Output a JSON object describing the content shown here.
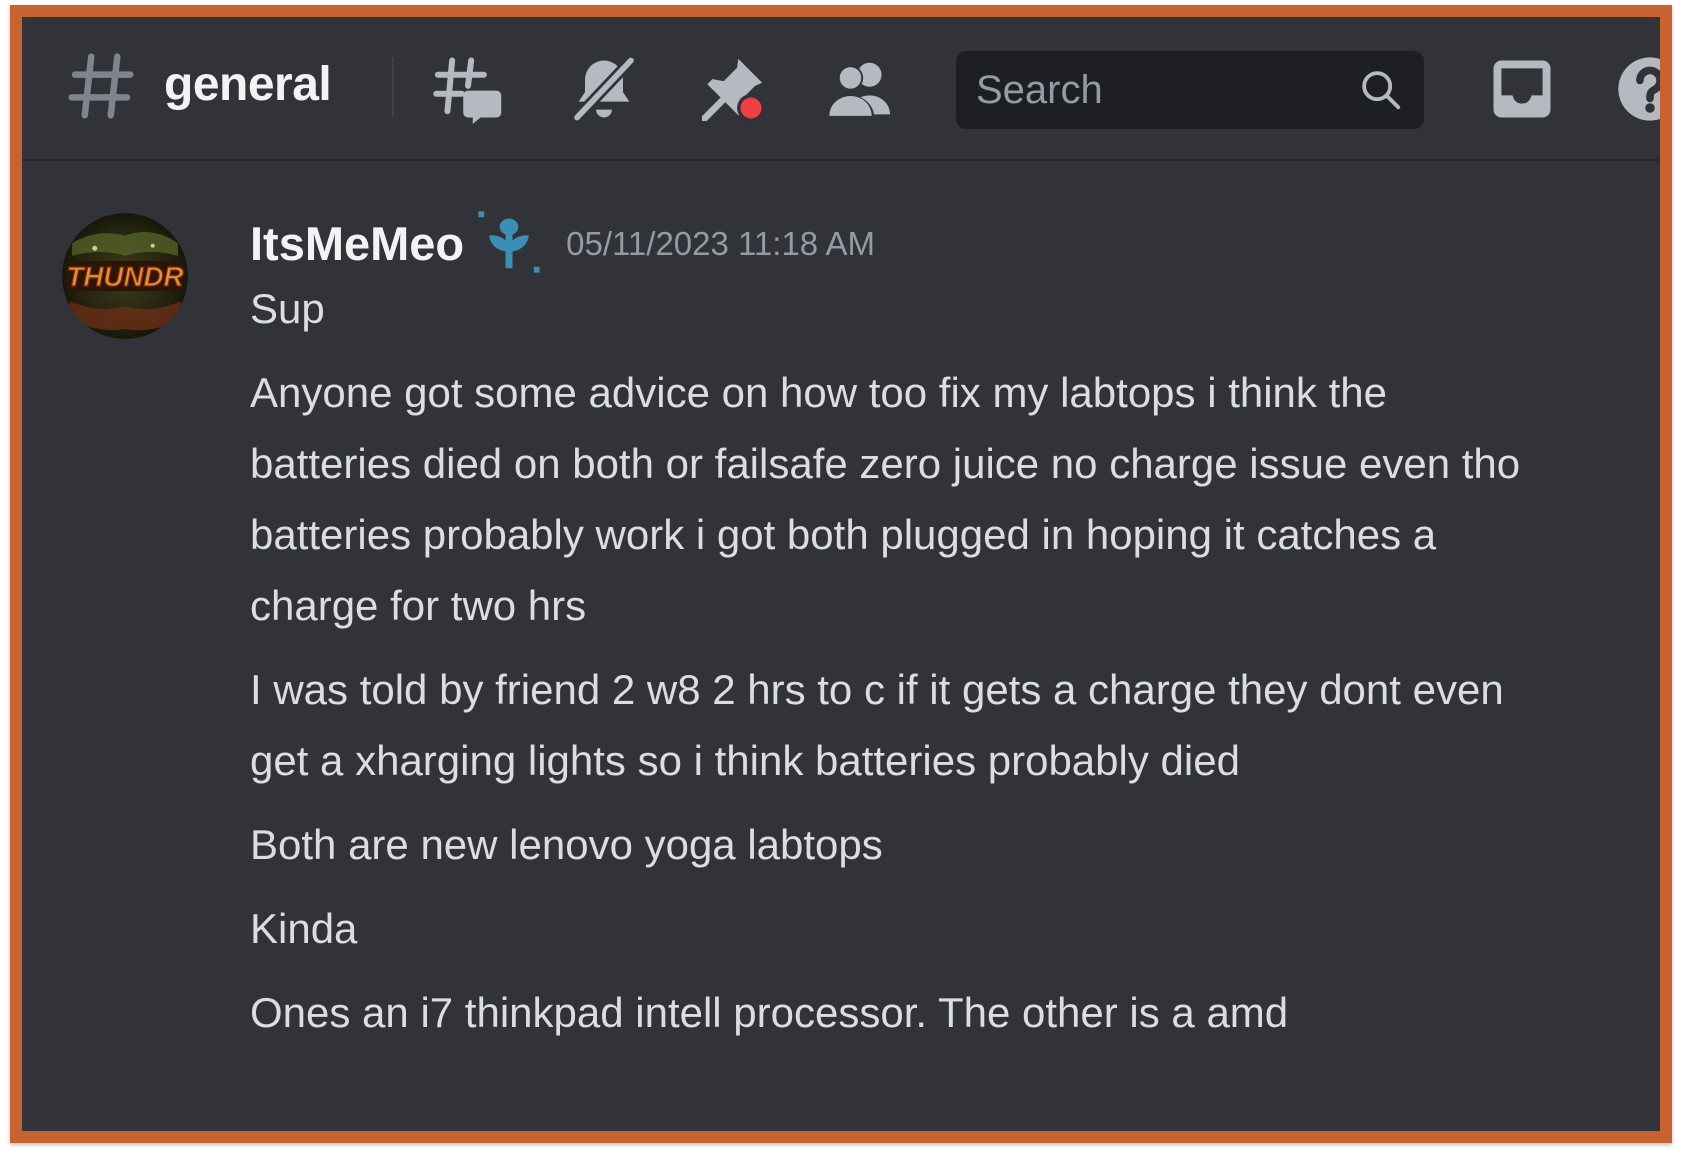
{
  "header": {
    "channel_name": "general",
    "icons": [
      "hash-icon",
      "threads-icon",
      "mute-notifications-icon",
      "pinned-messages-icon",
      "member-list-icon",
      "search-icon",
      "inbox-icon",
      "help-icon"
    ],
    "search": {
      "placeholder": "Search"
    },
    "colors": {
      "header_bg": "#313338",
      "icon": "#b5bac1",
      "search_bg": "#1e1f22",
      "pin_indicator": "#f23f43"
    }
  },
  "message": {
    "author": "ItsMeMeo",
    "timestamp": "05/11/2023 11:18 AM",
    "avatar": "avatar-image",
    "badge": "badge-icon",
    "lines": [
      "Sup",
      "Anyone got some advice on how too fix my labtops i think the batteries died on both or failsafe zero juice no charge issue even tho batteries probably work i got both plugged in hoping it catches a charge for two hrs",
      "I was told by friend 2 w8 2 hrs to c if it gets a charge they dont even get a xharging lights so i think batteries probably died",
      "Both are new lenovo yoga labtops",
      "Kinda",
      "Ones an i7 thinkpad intell processor. The other is a amd"
    ]
  },
  "frame": {
    "border_color": "#c8632f",
    "background": "#313338"
  }
}
